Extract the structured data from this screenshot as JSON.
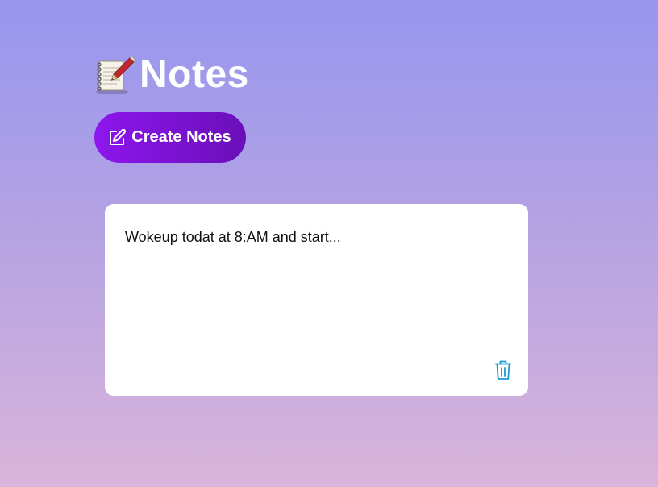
{
  "header": {
    "title": "Notes",
    "icon": "notebook-pencil-icon"
  },
  "toolbar": {
    "create_label": "Create Notes",
    "create_icon": "edit-icon"
  },
  "notes": [
    {
      "text": "Wokeup todat at 8:AM and start...",
      "delete_icon": "trash-icon"
    }
  ],
  "colors": {
    "background_top": "#9796ef",
    "background_bottom": "#dab4da",
    "button_start": "#8d16ee",
    "button_end": "#6a0fb8",
    "trash_icon": "#1a9ad6",
    "card": "#ffffff"
  }
}
